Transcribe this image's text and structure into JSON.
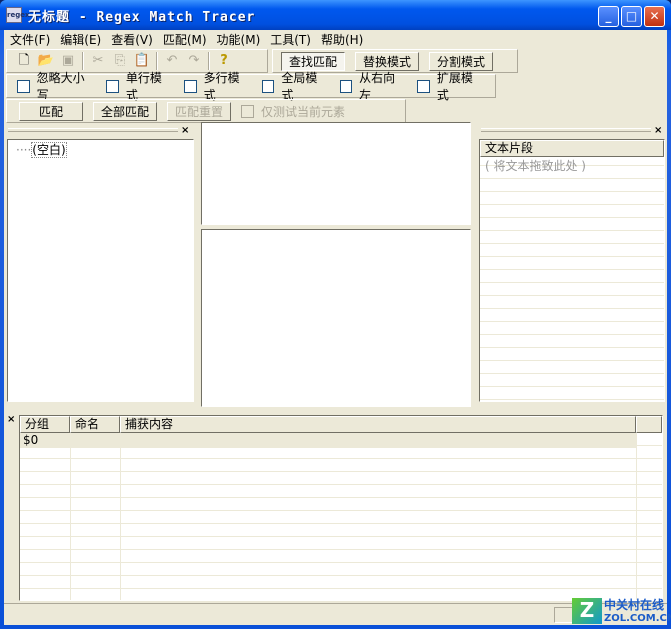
{
  "window": {
    "title": "无标题 - Regex Match Tracer",
    "icon_text": "regex",
    "minimize": "_",
    "maximize": "□",
    "close": "✕"
  },
  "menu": [
    "文件(F)",
    "编辑(E)",
    "查看(V)",
    "匹配(M)",
    "功能(M)",
    "工具(T)",
    "帮助(H)"
  ],
  "toolbar": {
    "mode_buttons": [
      "查找匹配",
      "替换模式",
      "分割模式"
    ]
  },
  "options": [
    "忽略大小写",
    "单行模式",
    "多行模式",
    "全局模式",
    "从右向左",
    "扩展模式"
  ],
  "actions": {
    "match": "匹配",
    "match_all": "全部匹配",
    "reset": "匹配重置",
    "test_current": "仅测试当前元素"
  },
  "left_pane": {
    "close": "×",
    "tree_item": "(空白)"
  },
  "right_pane": {
    "close": "×",
    "header": "文本片段",
    "placeholder": "( 将文本拖致此处 )"
  },
  "results": {
    "close": "×",
    "columns": [
      "分组",
      "命名",
      "捕获内容"
    ],
    "rows": [
      {
        "group": "$0",
        "name": "",
        "content": ""
      }
    ]
  },
  "watermark": {
    "brand": "中关村在线",
    "url": "ZOL.COM.CN"
  }
}
